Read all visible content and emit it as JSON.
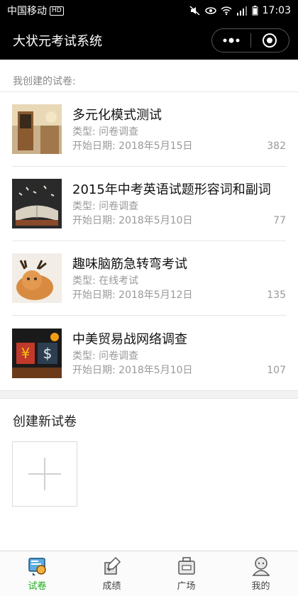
{
  "status_bar": {
    "carrier": "中国移动",
    "hd": "HD",
    "time": "17:03"
  },
  "header": {
    "title": "大状元考试系统"
  },
  "section_label": "我创建的试卷:",
  "papers": [
    {
      "title": "多元化模式测试",
      "type": "类型: 问卷调查",
      "date": "开始日期: 2018年5月15日",
      "count": "382"
    },
    {
      "title": "2015年中考英语试题形容词和副词",
      "type": "类型: 问卷调查",
      "date": "开始日期: 2018年5月10日",
      "count": "77"
    },
    {
      "title": "趣味脑筋急转弯考试",
      "type": "类型: 在线考试",
      "date": "开始日期: 2018年5月12日",
      "count": "135"
    },
    {
      "title": "中美贸易战网络调查",
      "type": "类型: 问卷调查",
      "date": "开始日期: 2018年5月10日",
      "count": "107"
    }
  ],
  "create": {
    "title": "创建新试卷"
  },
  "tabs": [
    {
      "label": "试卷",
      "icon": "exam-icon",
      "active": true
    },
    {
      "label": "成绩",
      "icon": "score-icon",
      "active": false
    },
    {
      "label": "广场",
      "icon": "plaza-icon",
      "active": false
    },
    {
      "label": "我的",
      "icon": "profile-icon",
      "active": false
    }
  ],
  "colors": {
    "accent": "#1aad19",
    "header_bg": "#000000"
  }
}
